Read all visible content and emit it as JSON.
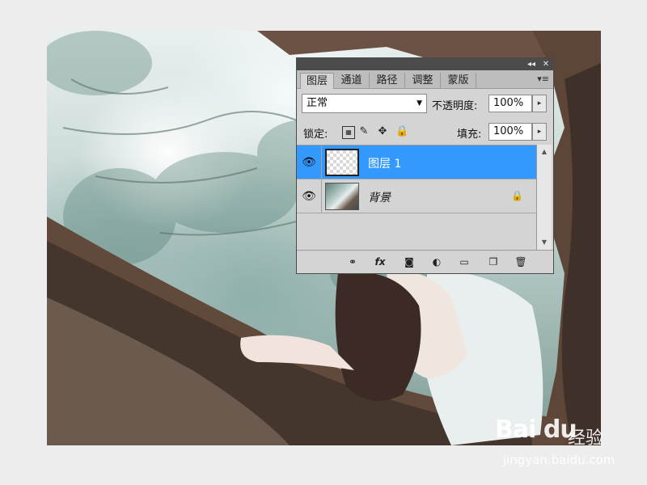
{
  "panel": {
    "tabs": [
      "图层",
      "通道",
      "路径",
      "调整",
      "蒙版"
    ],
    "active_tab": "图层",
    "titlebar_collapse": "◂◂",
    "titlebar_close": "✕",
    "menu_icon": "▾≡",
    "blend_mode": "正常",
    "opacity_label": "不透明度:",
    "opacity_value": "100%",
    "lock_label": "锁定:",
    "fill_label": "填充:",
    "fill_value": "100%",
    "layers": [
      {
        "name": "图层 1",
        "selected": true,
        "visible": true,
        "locked": false
      },
      {
        "name": "背景",
        "selected": false,
        "visible": true,
        "locked": true
      }
    ],
    "bottom_icons": [
      "link-icon",
      "fx-icon",
      "mask-icon",
      "adjustment-icon",
      "folder-icon",
      "new-layer-icon",
      "trash-icon"
    ]
  },
  "watermark": {
    "logo": "Bai du",
    "cn": "经验",
    "url": "jingyan.baidu.com"
  },
  "colors": {
    "selection": "#3399ff",
    "panel_bg": "#d4d4d4",
    "titlebar": "#4b4b4b"
  }
}
